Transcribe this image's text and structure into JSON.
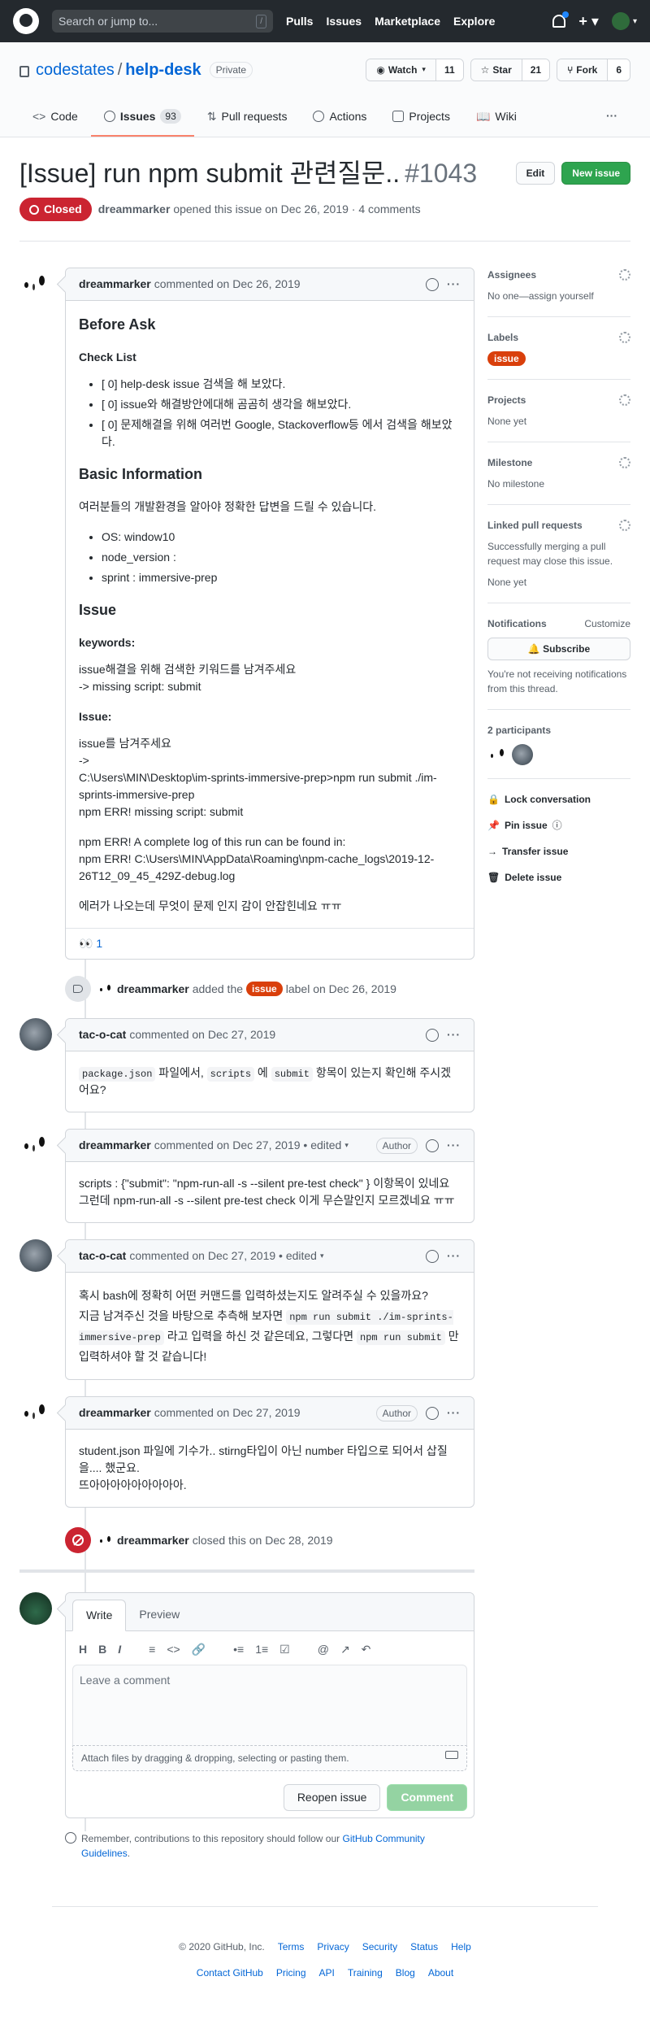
{
  "header": {
    "search_placeholder": "Search or jump to...",
    "search_key": "/",
    "nav": [
      "Pulls",
      "Issues",
      "Marketplace",
      "Explore"
    ]
  },
  "repo": {
    "owner": "codestates",
    "name": "help-desk",
    "visibility": "Private",
    "watch_label": "Watch",
    "watch_count": "11",
    "star_label": "Star",
    "star_count": "21",
    "fork_label": "Fork",
    "fork_count": "6",
    "tabs": [
      {
        "label": "Code"
      },
      {
        "label": "Issues",
        "count": "93"
      },
      {
        "label": "Pull requests"
      },
      {
        "label": "Actions"
      },
      {
        "label": "Projects"
      },
      {
        "label": "Wiki"
      }
    ],
    "more": "···"
  },
  "issue": {
    "title": "[Issue] run npm submit 관련질문..",
    "number": "#1043",
    "edit_label": "Edit",
    "new_label": "New issue",
    "state": "Closed",
    "author": "dreammarker",
    "opened_text": "opened this issue on Dec 26, 2019 · 4 comments"
  },
  "op": {
    "author": "dreammarker",
    "meta": "commented on Dec 26, 2019",
    "h_before": "Before Ask",
    "h_checklist": "Check List",
    "checklist": [
      "[ 0] help-desk issue 검색을 해 보았다.",
      "[ 0] issue와 해결방안에대해 곰곰히 생각을 해보았다.",
      "[ 0] 문제해결을 위해 여러번 Google, Stackoverflow등 에서 검색을 해보았다."
    ],
    "h_basic": "Basic Information",
    "basic_intro": "여러분들의 개발환경을 알아야 정확한 답변을 드릴 수 있습니다.",
    "basic_items": [
      "OS: window10",
      "node_version :",
      "sprint : immersive-prep"
    ],
    "h_issue": "Issue",
    "keywords_label": "keywords:",
    "keywords_line1": "issue해결을 위해 검색한 키워드를 남겨주세요",
    "keywords_line2": "-> missing script: submit",
    "issue_label": "Issue:",
    "issue_line1": "issue를 남겨주세요",
    "issue_line2": "->",
    "issue_line3": "C:\\Users\\MIN\\Desktop\\im-sprints-immersive-prep>npm run submit ./im-sprints-immersive-prep",
    "issue_line4": "npm ERR! missing script: submit",
    "log_line1": "npm ERR! A complete log of this run can be found in:",
    "log_line2": "npm ERR! C:\\Users\\MIN\\AppData\\Roaming\\npm-cache_logs\\2019-12-26T12_09_45_429Z-debug.log",
    "closing": "에러가 나오는데 무엇이 문제 인지 감이 안잡힌네요 ㅠㅠ",
    "reaction_emoji": "👀",
    "reaction_count": "1"
  },
  "event_label": {
    "author": "dreammarker",
    "pre": "added the",
    "label": "issue",
    "post": "label on Dec 26, 2019"
  },
  "comments": [
    {
      "author": "tac-o-cat",
      "meta": "commented on Dec 27, 2019",
      "parts": [
        "package.json",
        " 파일에서, ",
        "scripts",
        " 에 ",
        "submit",
        " 항목이 있는지 확인해 주시겠어요?"
      ]
    },
    {
      "author": "dreammarker",
      "meta": "commented on Dec 27, 2019 • edited",
      "badge": "Author",
      "line1": "scripts : {\"submit\": \"npm-run-all -s --silent pre-test check\" } 이항목이 있네요",
      "line2": "그런데 npm-run-all -s --silent pre-test check 이게 무슨말인지 모르겠네요 ㅠㅠ"
    },
    {
      "author": "tac-o-cat",
      "meta": "commented on Dec 27, 2019 • edited",
      "line1": "혹시 bash에 정확히 어떤 커맨드를 입력하셨는지도 알려주실 수 있을까요?",
      "line2_pre": "지금 남겨주신 것을 바탕으로 추측해 보자면 ",
      "code1": "npm run submit ./im-sprints-immersive-prep",
      "line2_mid": " 라고 입력을 하신 것 같은데요, 그렇다면 ",
      "code2": "npm run submit",
      "line2_post": " 만 입력하셔야 할 것 같습니다!"
    },
    {
      "author": "dreammarker",
      "meta": "commented on Dec 27, 2019",
      "badge": "Author",
      "line1": "student.json 파일에 기수가.. stirng타입이 아닌 number 타입으로 되어서 삽질을.... 했군요.",
      "line2": "뜨아아아아아아아아아."
    }
  ],
  "event_closed": {
    "author": "dreammarker",
    "text": "closed this on Dec 28, 2019"
  },
  "form": {
    "tab_write": "Write",
    "tab_preview": "Preview",
    "toolbar": [
      "H",
      "B",
      "I",
      "≡",
      "<>",
      "🔗",
      "•≡",
      "1≡",
      "☑",
      "@",
      "↗",
      "↶"
    ],
    "placeholder": "Leave a comment",
    "attach": "Attach files by dragging & dropping, selecting or pasting them.",
    "reopen": "Reopen issue",
    "comment": "Comment",
    "guidelines_pre": "Remember, contributions to this repository should follow our ",
    "guidelines_link": "GitHub Community Guidelines",
    "guidelines_post": "."
  },
  "sidebar": {
    "assignees_h": "Assignees",
    "assignees_v": "No one—assign yourself",
    "labels_h": "Labels",
    "labels_v": "issue",
    "projects_h": "Projects",
    "projects_v": "None yet",
    "milestone_h": "Milestone",
    "milestone_v": "No milestone",
    "linked_h": "Linked pull requests",
    "linked_desc": "Successfully merging a pull request may close this issue.",
    "linked_v": "None yet",
    "notif_h": "Notifications",
    "notif_customize": "Customize",
    "subscribe": "Subscribe",
    "notif_desc": "You're not receiving notifications from this thread.",
    "participants_h": "2 participants",
    "lock": "Lock conversation",
    "pin": "Pin issue",
    "transfer": "Transfer issue",
    "delete": "Delete issue"
  },
  "footer": {
    "copyright": "© 2020 GitHub, Inc.",
    "row1": [
      "Terms",
      "Privacy",
      "Security",
      "Status",
      "Help"
    ],
    "row2": [
      "Contact GitHub",
      "Pricing",
      "API",
      "Training",
      "Blog",
      "About"
    ]
  },
  "colors": {
    "closed": "#cb2431",
    "label_issue": "#d93f0b",
    "new_issue": "#2ea44f",
    "header_bg": "#24292e"
  }
}
